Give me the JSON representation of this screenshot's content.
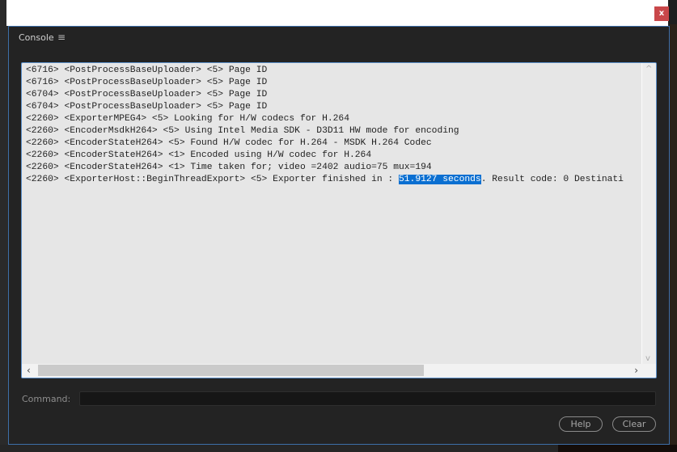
{
  "window": {
    "close_label": "x"
  },
  "console": {
    "tab_label": "Console",
    "menu_icon": "hamburger-icon",
    "lines": [
      "<6716> <PostProcessBaseUploader> <5> Page ID",
      "<6716> <PostProcessBaseUploader> <5> Page ID",
      "<6704> <PostProcessBaseUploader> <5> Page ID",
      "<6704> <PostProcessBaseUploader> <5> Page ID",
      "<2260> <ExporterMPEG4> <5> Looking for H/W codecs for H.264",
      "<2260> <EncoderMsdkH264> <5> Using Intel Media SDK - D3D11 HW mode for encoding",
      "<2260> <EncoderStateH264> <5> Found H/W codec for H.264 - MSDK H.264 Codec",
      "<2260> <EncoderStateH264> <1> Encoded using H/W codec for H.264",
      "<2260> <EncoderStateH264> <1> Time taken for; video =2402 audio=75 mux=194"
    ],
    "last_line": {
      "prefix": "<2260> <ExporterHost::BeginThreadExport> <5> Exporter finished in : ",
      "selected": "51.9127 seconds",
      "suffix": ". Result code: 0 Destinati"
    },
    "selection_color": "#0a6fd1",
    "command_label": "Command:",
    "command_value": "",
    "help_label": "Help",
    "clear_label": "Clear"
  }
}
